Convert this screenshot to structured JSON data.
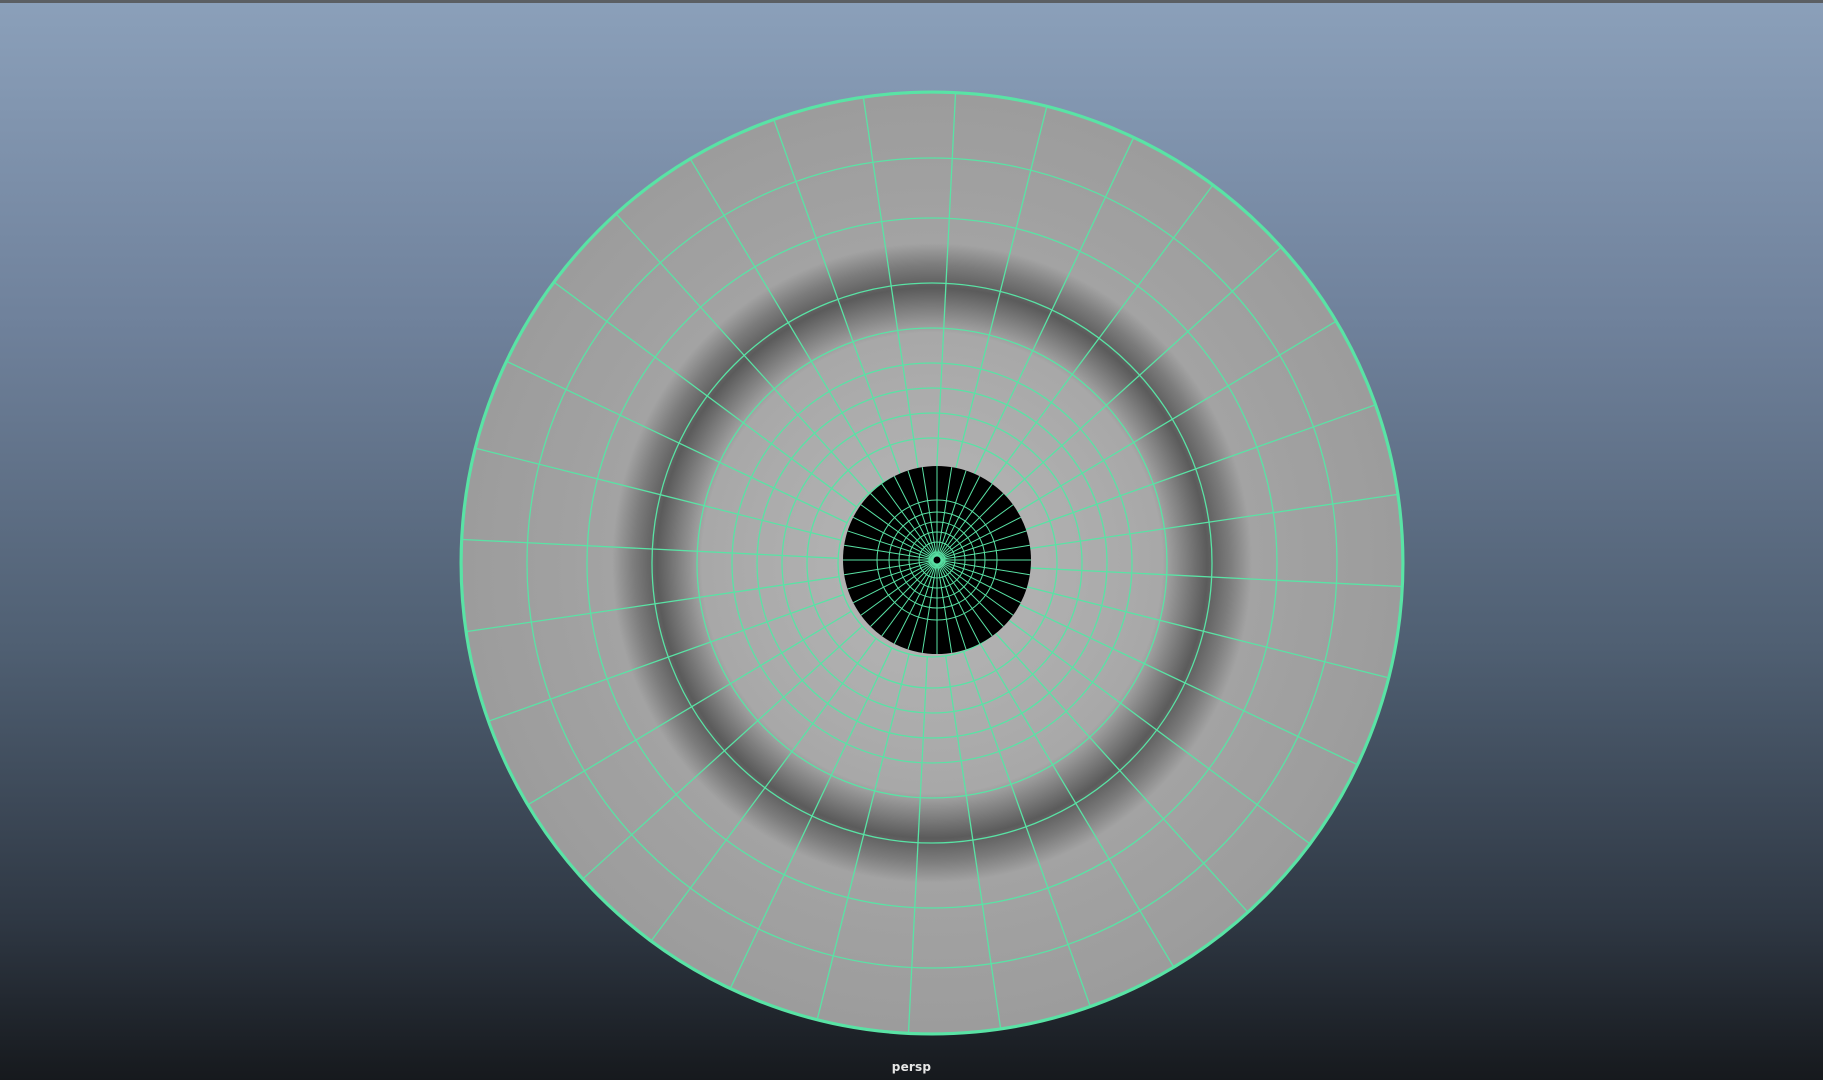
{
  "viewport": {
    "camera_name": "persp"
  },
  "colors": {
    "wireframe": "#59e3a5",
    "mesh_surface": "#a8a8a8",
    "pupil": "#000000"
  }
}
